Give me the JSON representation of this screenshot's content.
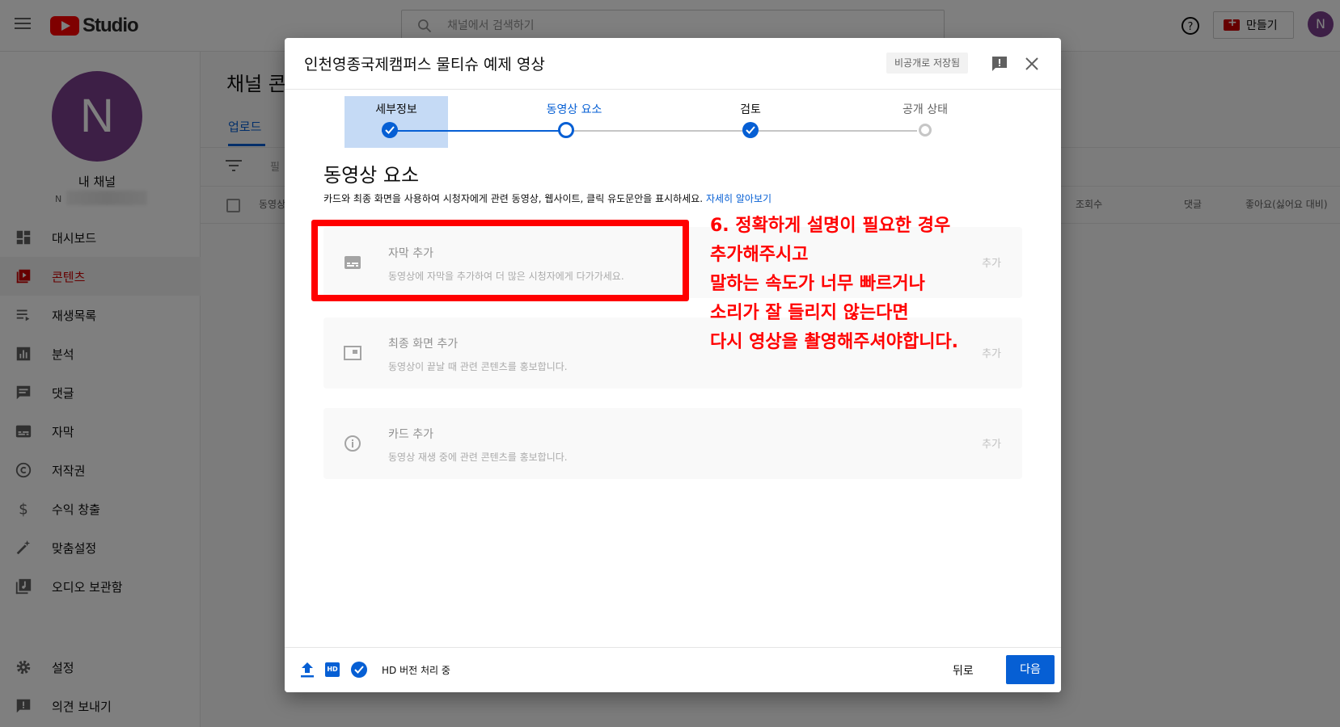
{
  "topbar": {
    "logo_text": "Studio",
    "search_placeholder": "채널에서 검색하기",
    "create_label": "만들기",
    "avatar_letter": "N"
  },
  "sidebar": {
    "avatar_letter": "N",
    "channel_name": "내 채널",
    "channel_handle": "N",
    "items": [
      {
        "label": "대시보드",
        "icon": "dashboard-icon"
      },
      {
        "label": "콘텐츠",
        "icon": "content-icon",
        "active": true
      },
      {
        "label": "재생목록",
        "icon": "playlist-icon"
      },
      {
        "label": "분석",
        "icon": "analytics-icon"
      },
      {
        "label": "댓글",
        "icon": "comments-icon"
      },
      {
        "label": "자막",
        "icon": "subtitles-icon"
      },
      {
        "label": "저작권",
        "icon": "copyright-icon"
      },
      {
        "label": "수익 창출",
        "icon": "dollar-icon"
      },
      {
        "label": "맞춤설정",
        "icon": "magic-wand-icon"
      },
      {
        "label": "오디오 보관함",
        "icon": "audio-library-icon"
      }
    ],
    "bottom_items": [
      {
        "label": "설정",
        "icon": "gear-icon"
      },
      {
        "label": "의견 보내기",
        "icon": "feedback-icon"
      }
    ]
  },
  "background": {
    "page_title": "채널 콘",
    "tab_upload": "업로드",
    "filter_text": "필",
    "columns": [
      "동영상",
      "조회수",
      "댓글",
      "좋아요(싫어요 대비)"
    ]
  },
  "dialog": {
    "title": "인천영종국제캠퍼스 물티슈 예제 영상",
    "saved_badge": "비공개로 저장됨",
    "steps": [
      {
        "label": "세부정보",
        "state": "done"
      },
      {
        "label": "동영상 요소",
        "state": "current"
      },
      {
        "label": "검토",
        "state": "done"
      },
      {
        "label": "공개 상태",
        "state": "todo"
      }
    ],
    "section_title": "동영상 요소",
    "section_desc": "카드와 최종 화면을 사용하여 시청자에게 관련 동영상, 웹사이트, 클릭 유도문안을 표시하세요. ",
    "learn_more": "자세히 알아보기",
    "cards": [
      {
        "title": "자막 추가",
        "subtitle": "동영상에 자막을 추가하여 더 많은 시청자에게 다가가세요.",
        "action": "추가",
        "icon": "subtitles-icon"
      },
      {
        "title": "최종 화면 추가",
        "subtitle": "동영상이 끝날 때 관련 콘텐츠를 홍보합니다.",
        "action": "추가",
        "icon": "end-screen-icon"
      },
      {
        "title": "카드 추가",
        "subtitle": "동영상 재생 중에 관련 콘텐츠를 홍보합니다.",
        "action": "추가",
        "icon": "info-icon"
      }
    ],
    "footer": {
      "hd_badge": "HD",
      "status": "HD 버전 처리 중",
      "back_label": "뒤로",
      "next_label": "다음"
    }
  },
  "annotation": {
    "lines": [
      "6. 정확하게 설명이 필요한 경우",
      "추가해주시고",
      "말하는 속도가 너무 빠르거나",
      "소리가 잘 들리지 않는다면",
      "다시 영상을 촬영해주셔야합니다."
    ],
    "color": "#ff0000"
  },
  "colors": {
    "accent": "#065fd4",
    "brand_red": "#ff0000",
    "avatar": "#7b3e8c"
  }
}
